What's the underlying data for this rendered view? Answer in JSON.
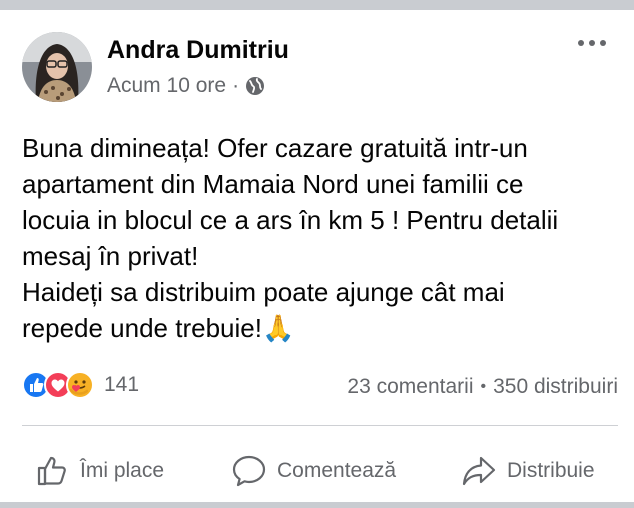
{
  "post": {
    "author": "Andra Dumitriu",
    "time": "Acum 10 ore",
    "separator": "·",
    "privacy_icon": "globe-icon",
    "more_icon": "more-horizontal-icon",
    "text_lines": [
      "Buna dimineața!  Ofer cazare gratuită intr-un",
      "apartament din Mamaia Nord unei familii ce",
      "locuia in blocul ce a ars în km 5 ! Pentru detalii",
      "mesaj în privat!",
      "Haideți sa distribuim poate ajunge cât mai",
      "repede unde trebuie!"
    ],
    "emoji": "🙏"
  },
  "reactions": {
    "icons": [
      "like-reaction-icon",
      "love-reaction-icon",
      "care-reaction-icon"
    ],
    "count": "141",
    "comments": "23 comentarii",
    "dot": "•",
    "shares": "350 distribuiri"
  },
  "actions": {
    "like": "Îmi place",
    "comment": "Comentează",
    "share": "Distribuie"
  },
  "colors": {
    "like_blue": "#1877f2",
    "love_red": "#f33e58",
    "care_yellow": "#f7b125",
    "secondary_text": "#65676b"
  }
}
